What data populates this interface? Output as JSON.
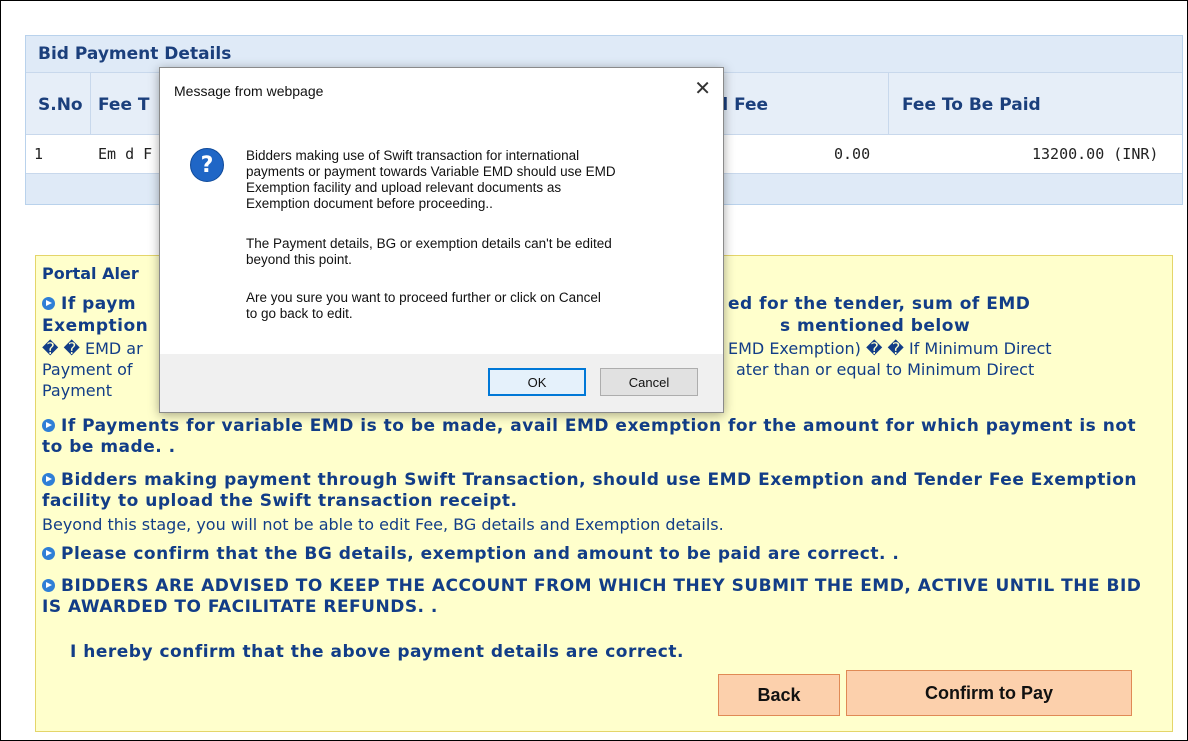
{
  "bid_panel": {
    "title": "Bid Payment Details",
    "headers": {
      "sno": "S.No",
      "fee_type": "Fee T",
      "paid_fee": "d Fee",
      "to_be_paid": "Fee To Be Paid"
    },
    "row": {
      "sno": "1",
      "fee_type": "Em d F",
      "paid_fee": "0.00",
      "to_be_paid": "13200.00 (INR)"
    }
  },
  "alert": {
    "title": "Portal Aler",
    "p1_line1_left": "If paym",
    "p1_line1_right": "ed for the tender, sum of EMD",
    "p1_line2_left": "Exemption",
    "p1_line2_right": "s mentioned below",
    "p1_line3_left": "� � EMD ar",
    "p1_line3_right": "EMD Exemption) � � If Minimum Direct",
    "p1_line4_left": "Payment of",
    "p1_line4_right": "ater than or equal to Minimum Direct",
    "p1_line5": "Payment",
    "p2": "If Payments for variable EMD is to be made, avail EMD exemption for the amount for which payment is not to be made. .",
    "p3": "Bidders making payment through Swift Transaction, should use EMD Exemption and Tender Fee Exemption facility to upload the Swift transaction receipt.",
    "p3_plain": "Beyond this stage, you will not be able to edit Fee, BG details and Exemption details.",
    "p4": "Please confirm that the BG details, exemption and amount to be paid are correct. .",
    "p5": "BIDDERS ARE ADVISED TO KEEP THE ACCOUNT FROM WHICH THEY SUBMIT THE EMD, ACTIVE UNTIL THE BID IS AWARDED TO FACILITATE REFUNDS. .",
    "confirm_text": "I hereby confirm that the above payment details are correct.",
    "back_label": "Back",
    "confirm_label": "Confirm to Pay"
  },
  "dialog": {
    "title": "Message from webpage",
    "close_glyph": "✕",
    "icon_glyph": "?",
    "msg1": "Bidders making use of Swift transaction for international\npayments or payment towards Variable EMD should use EMD\nExemption facility and upload relevant documents as\nExemption document before proceeding..",
    "msg2": "The Payment details, BG or exemption details can't be edited\nbeyond this point.",
    "msg3": "Are you sure you want to proceed further or click on Cancel\nto go back to edit.",
    "ok_label": "OK",
    "cancel_label": "Cancel"
  }
}
